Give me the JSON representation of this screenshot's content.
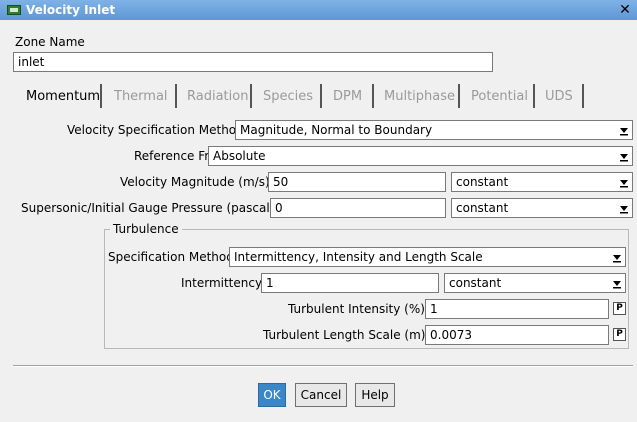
{
  "window": {
    "title": "Velocity Inlet",
    "close_label": "✕"
  },
  "zone": {
    "label": "Zone Name",
    "value": "inlet"
  },
  "tabs": [
    {
      "label": "Momentum",
      "enabled": true
    },
    {
      "label": "Thermal",
      "enabled": false
    },
    {
      "label": "Radiation",
      "enabled": false
    },
    {
      "label": "Species",
      "enabled": false
    },
    {
      "label": "DPM",
      "enabled": false
    },
    {
      "label": "Multiphase",
      "enabled": false
    },
    {
      "label": "Potential",
      "enabled": false
    },
    {
      "label": "UDS",
      "enabled": false
    }
  ],
  "momentum": {
    "velocity_spec": {
      "label": "Velocity Specification Method",
      "value": "Magnitude, Normal to Boundary"
    },
    "reference_frame": {
      "label": "Reference Frame",
      "value": "Absolute"
    },
    "velocity_magnitude": {
      "label": "Velocity Magnitude (m/s)",
      "value": "50",
      "method": "constant"
    },
    "gauge_pressure": {
      "label": "Supersonic/Initial Gauge Pressure (pascal)",
      "value": "0",
      "method": "constant"
    }
  },
  "turbulence": {
    "group_label": "Turbulence",
    "spec_method": {
      "label": "Specification Method",
      "value": "Intermittency, Intensity and Length Scale"
    },
    "intermittency": {
      "label": "Intermittency",
      "value": "1",
      "method": "constant"
    },
    "intensity": {
      "label": "Turbulent Intensity (%)",
      "value": "1",
      "param": "P"
    },
    "length_scale": {
      "label": "Turbulent Length Scale (m)",
      "value": "0.0073",
      "param": "P"
    }
  },
  "buttons": {
    "ok": "OK",
    "cancel": "Cancel",
    "help": "Help"
  }
}
